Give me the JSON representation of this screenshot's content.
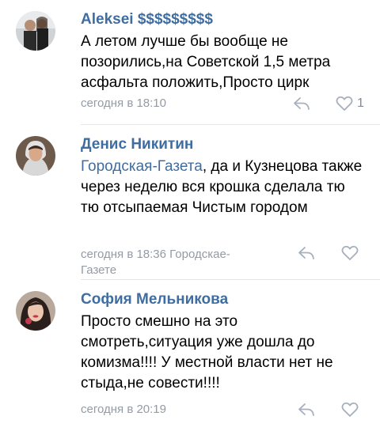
{
  "comments": [
    {
      "author": "Aleksei $$$$$$$$$",
      "text": "А летом лучше бы вообще не позорились,на Советской 1,5 метра асфальта положить,Просто цирк",
      "timestamp": "сегодня в 18:10",
      "likes": "1",
      "avatar": "male-avatar-with-companion"
    },
    {
      "author": "Денис Никитин",
      "mention": "Городская-Газета",
      "text": ", да и Кузнецова также через неделю вся крошка сделала тю тю отсыпаемая Чистым городом",
      "timestamp": "сегодня в 18:36 Городскае-Газете",
      "avatar": "male-avatar-hood"
    },
    {
      "author": "София Мельникова",
      "text": "Просто смешно на это смотреть,ситуация уже дошла до комизма!!!! У местной власти нет не стыда,не совести!!!!",
      "timestamp": "сегодня в 20:19",
      "avatar": "female-avatar"
    }
  ],
  "colors": {
    "link": "#3f6da0",
    "meta": "#939ba5",
    "icon": "#a7b0bc",
    "divider": "#e2e5e9"
  }
}
